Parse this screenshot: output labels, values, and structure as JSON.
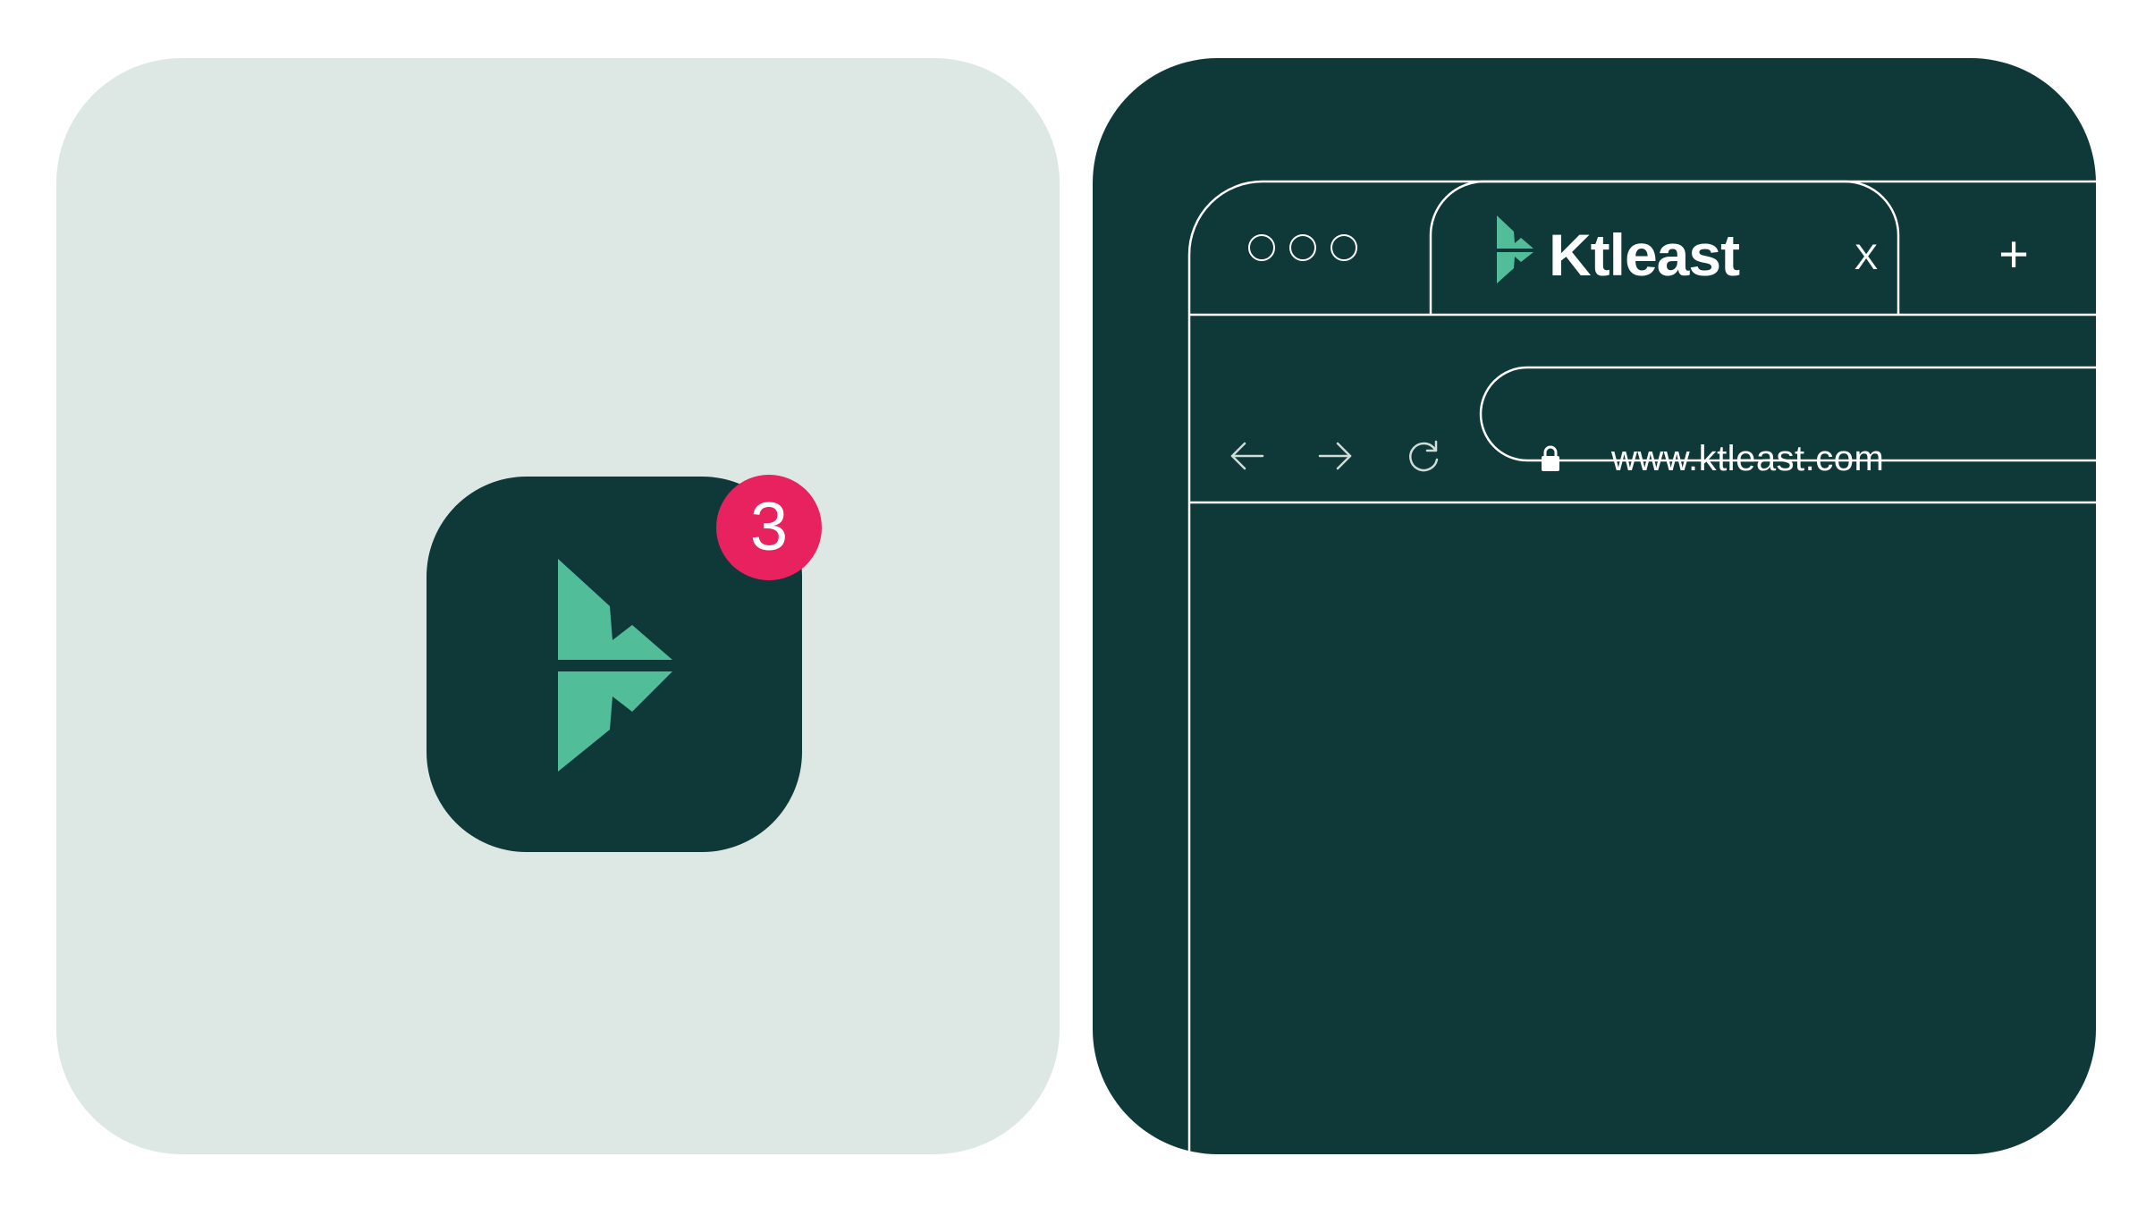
{
  "app_icon": {
    "badge_count": "3",
    "background_color": "#0f3838",
    "logo_color": "#52be99",
    "badge_color": "#e8225f",
    "icon": "ktleast-logo-icon"
  },
  "browser": {
    "window_controls": [
      "circle-icon",
      "circle-icon",
      "circle-icon"
    ],
    "tab": {
      "title": "Ktleast",
      "close_label": "X",
      "icon": "ktleast-logo-icon"
    },
    "new_tab_label": "+",
    "nav": {
      "back_icon": "arrow-left-icon",
      "forward_icon": "arrow-right-icon",
      "reload_icon": "reload-icon"
    },
    "address_bar": {
      "lock_icon": "lock-icon",
      "url": "www.ktleast.com"
    },
    "colors": {
      "frame": "#0f3838",
      "lines": "#ffffff",
      "accent": "#52be99"
    }
  },
  "colors": {
    "left_card_background": "#dde8e4",
    "page_background": "#ffffff"
  }
}
